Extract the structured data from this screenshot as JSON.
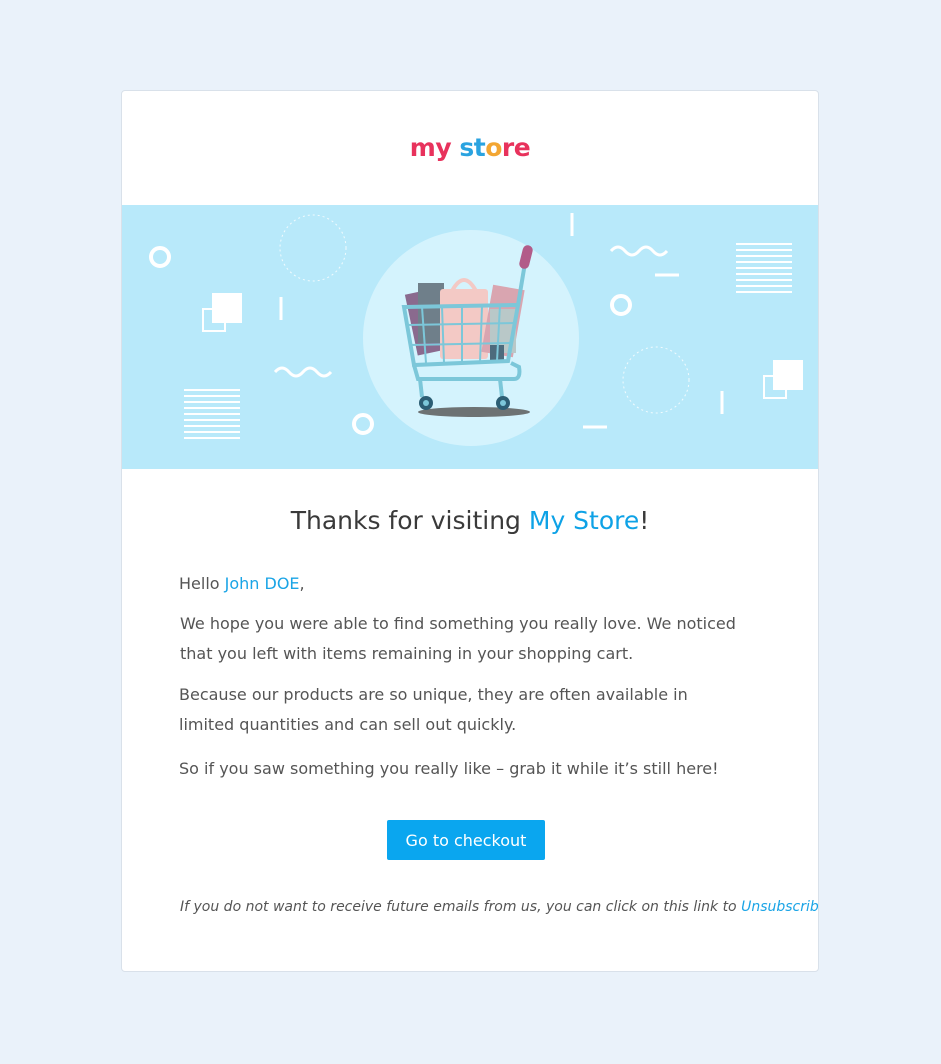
{
  "logo": {
    "part1": "my",
    "part2": "st",
    "part3": "o",
    "part4": "re"
  },
  "heading": {
    "prefix": "Thanks for visiting ",
    "store": "My Store",
    "suffix": "!"
  },
  "greeting": {
    "hello": "Hello ",
    "name": "John DOE",
    "suffix": ","
  },
  "paragraphs": [
    "We hope you were able to find something you really love. We noticed that you left with items remaining in your shopping cart.",
    "Because our products are so unique, they are often available in limited quantities and can sell out quickly.",
    "So if you saw something you really like – grab it while it’s still here!"
  ],
  "cta": {
    "label": "Go to checkout"
  },
  "footer": {
    "text": "If you do not want to receive future emails from us, you can click on this link to ",
    "link": "Unsubscribe."
  },
  "colors": {
    "page_bg": "#eaf2fa",
    "banner_bg": "#b8e9fa",
    "accent": "#0aa6ef"
  },
  "icons": [
    "shopping-cart-illustration"
  ]
}
